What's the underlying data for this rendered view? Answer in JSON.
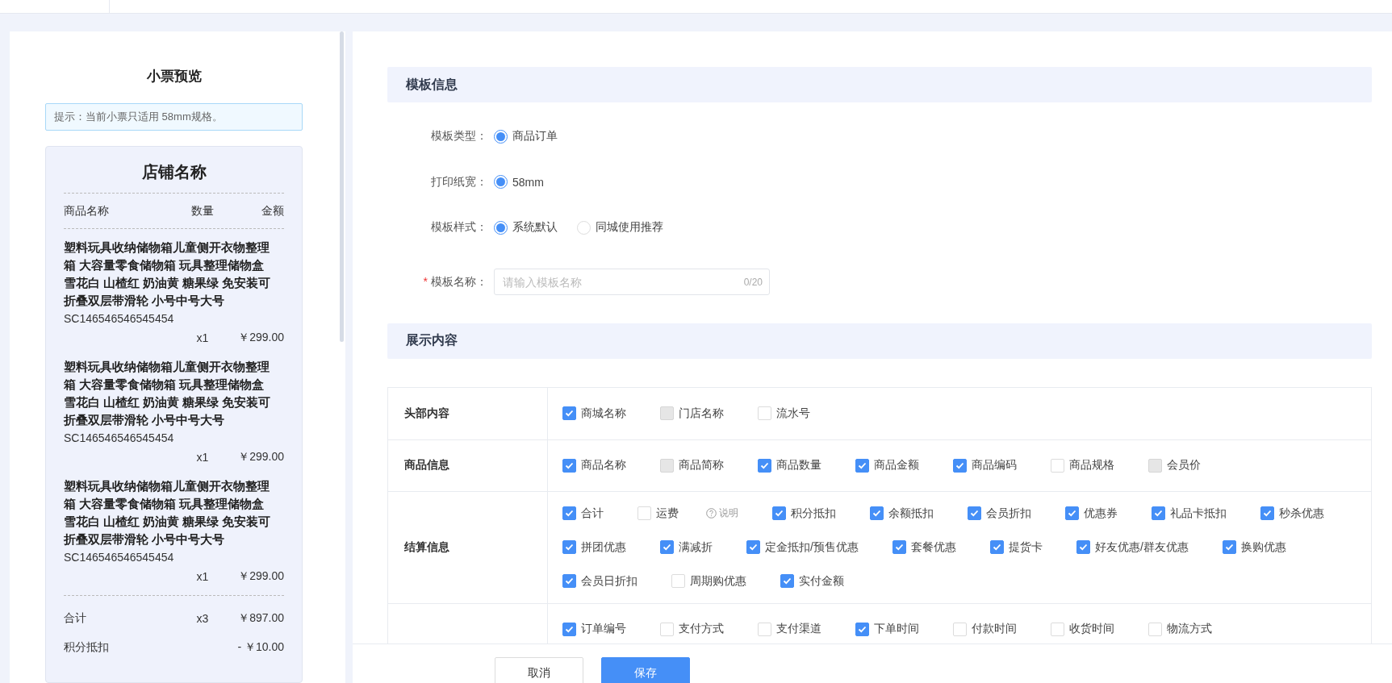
{
  "preview": {
    "title": "小票预览",
    "tip": "提示：当前小票只适用 58mm规格。",
    "receipt": {
      "store_name": "店铺名称",
      "columns": [
        "商品名称",
        "数量",
        "金额"
      ],
      "items": [
        {
          "name_lines": [
            "塑料玩具收纳储物箱儿童侧开衣物整理",
            "箱 大容量零食储物箱 玩具整理储物盒",
            "雪花白 山楂红 奶油黄 糖果绿 免安装可",
            "折叠双层带滑轮 小号中号大号"
          ],
          "code": "SC146546546545454",
          "qty": "x1",
          "amount": "￥299.00"
        },
        {
          "name_lines": [
            "塑料玩具收纳储物箱儿童侧开衣物整理",
            "箱 大容量零食储物箱 玩具整理储物盒",
            "雪花白 山楂红 奶油黄 糖果绿 免安装可",
            "折叠双层带滑轮 小号中号大号"
          ],
          "code": "SC146546546545454",
          "qty": "x1",
          "amount": "￥299.00"
        },
        {
          "name_lines": [
            "塑料玩具收纳储物箱儿童侧开衣物整理",
            "箱 大容量零食储物箱 玩具整理储物盒",
            "雪花白 山楂红 奶油黄 糖果绿 免安装可",
            "折叠双层带滑轮 小号中号大号"
          ],
          "code": "SC146546546545454",
          "qty": "x1",
          "amount": "￥299.00"
        }
      ],
      "summary": [
        {
          "label": "合计",
          "qty": "x3",
          "amount": "￥897.00"
        },
        {
          "label": "积分抵扣",
          "amount": "- ￥10.00"
        }
      ]
    }
  },
  "template_info": {
    "title": "模板信息",
    "fields": [
      {
        "kind": "radio",
        "label": "模板类型：",
        "options": [
          {
            "label": "商品订单",
            "selected": true
          }
        ]
      },
      {
        "kind": "radio",
        "label": "打印纸宽：",
        "options": [
          {
            "label": "58mm",
            "selected": true
          }
        ]
      },
      {
        "kind": "radio",
        "label": "模板样式：",
        "options": [
          {
            "label": "系统默认",
            "selected": true
          },
          {
            "label": "同城使用推荐",
            "selected": false
          }
        ]
      },
      {
        "kind": "input",
        "label": "模板名称：",
        "required_mark": "*",
        "placeholder": "请输入模板名称",
        "counter": "0/20"
      }
    ]
  },
  "display_content": {
    "title": "展示内容",
    "rows": [
      {
        "label": "头部内容",
        "options": [
          {
            "label": "商城名称",
            "checked": true,
            "disabled": false
          },
          {
            "label": "门店名称",
            "checked": false,
            "disabled": true
          },
          {
            "label": "流水号",
            "checked": false,
            "disabled": false
          }
        ]
      },
      {
        "label": "商品信息",
        "options": [
          {
            "label": "商品名称",
            "checked": true,
            "disabled": false
          },
          {
            "label": "商品简称",
            "checked": false,
            "disabled": true
          },
          {
            "label": "商品数量",
            "checked": true,
            "disabled": false
          },
          {
            "label": "商品金额",
            "checked": true,
            "disabled": false
          },
          {
            "label": "商品编码",
            "checked": true,
            "disabled": false
          },
          {
            "label": "商品规格",
            "checked": false,
            "disabled": false
          },
          {
            "label": "会员价",
            "checked": false,
            "disabled": true
          }
        ]
      },
      {
        "label": "结算信息",
        "options": [
          {
            "label": "合计",
            "checked": true,
            "disabled": false
          },
          {
            "label": "运费",
            "checked": false,
            "disabled": false,
            "note": "说明"
          },
          {
            "label": "积分抵扣",
            "checked": true,
            "disabled": false
          },
          {
            "label": "余额抵扣",
            "checked": true,
            "disabled": false
          },
          {
            "label": "会员折扣",
            "checked": true,
            "disabled": false
          },
          {
            "label": "优惠券",
            "checked": true,
            "disabled": false
          },
          {
            "label": "礼品卡抵扣",
            "checked": true,
            "disabled": false
          },
          {
            "label": "秒杀优惠",
            "checked": true,
            "disabled": false
          },
          {
            "label": "拼团优惠",
            "checked": true,
            "disabled": false
          },
          {
            "label": "满减折",
            "checked": true,
            "disabled": false
          },
          {
            "label": "定金抵扣/预售优惠",
            "checked": true,
            "disabled": false
          },
          {
            "label": "套餐优惠",
            "checked": true,
            "disabled": false
          },
          {
            "label": "提货卡",
            "checked": true,
            "disabled": false
          },
          {
            "label": "好友优惠/群友优惠",
            "checked": true,
            "disabled": false
          },
          {
            "label": "换购优惠",
            "checked": true,
            "disabled": false
          },
          {
            "label": "会员日折扣",
            "checked": true,
            "disabled": false
          },
          {
            "label": "周期购优惠",
            "checked": false,
            "disabled": false
          },
          {
            "label": "实付金额",
            "checked": true,
            "disabled": false
          }
        ]
      },
      {
        "options": [
          {
            "label": "订单编号",
            "checked": true,
            "disabled": false
          },
          {
            "label": "支付方式",
            "checked": false,
            "disabled": false
          },
          {
            "label": "支付渠道",
            "checked": false,
            "disabled": false
          },
          {
            "label": "下单时间",
            "checked": true,
            "disabled": false
          },
          {
            "label": "付款时间",
            "checked": false,
            "disabled": false
          },
          {
            "label": "收货时间",
            "checked": false,
            "disabled": false
          },
          {
            "label": "物流方式",
            "checked": false,
            "disabled": false
          }
        ]
      }
    ]
  },
  "actions": [
    {
      "label": "取消",
      "kind": "secondary"
    },
    {
      "label": "保存",
      "kind": "primary"
    }
  ]
}
